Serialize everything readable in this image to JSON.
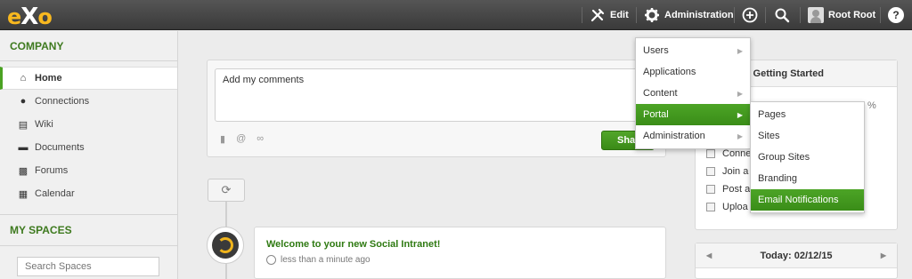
{
  "topbar": {
    "logo_e": "e",
    "logo_x": "X",
    "logo_o": "o",
    "edit_label": "Edit",
    "administration_label": "Administration",
    "user_name": "Root Root",
    "help_glyph": "?"
  },
  "sidebar": {
    "company_heading": "COMPANY",
    "items": [
      {
        "label": "Home",
        "icon": "home-icon"
      },
      {
        "label": "Connections",
        "icon": "person-icon"
      },
      {
        "label": "Wiki",
        "icon": "book-icon"
      },
      {
        "label": "Documents",
        "icon": "folder-icon"
      },
      {
        "label": "Forums",
        "icon": "chat-icon"
      },
      {
        "label": "Calendar",
        "icon": "calendar-icon"
      }
    ],
    "spaces_heading": "MY SPACES",
    "search_placeholder": "Search Spaces"
  },
  "composer": {
    "value": "Add my comments",
    "tools": [
      "file-icon",
      "at-icon",
      "link-icon"
    ],
    "share_label": "Share"
  },
  "activity": {
    "title": "Welcome to your new Social Intranet!",
    "time": "less than a minute ago"
  },
  "getting_started": {
    "title": "Getting Started",
    "percent_sign": "%",
    "items": [
      "Conne",
      "Join a",
      "Post a",
      "Uploa"
    ]
  },
  "calendar": {
    "today": "Today: 02/12/15"
  },
  "admin_menu": {
    "items": [
      "Users",
      "Applications",
      "Content",
      "Portal",
      "Administration"
    ],
    "highlighted": "Portal"
  },
  "portal_submenu": {
    "items": [
      "Pages",
      "Sites",
      "Group Sites",
      "Branding",
      "Email Notifications"
    ],
    "highlighted": "Email Notifications"
  },
  "colors": {
    "accent_green": "#4aa222",
    "logo_yellow": "#f8b81f",
    "topbar": "#3a3a3a"
  }
}
